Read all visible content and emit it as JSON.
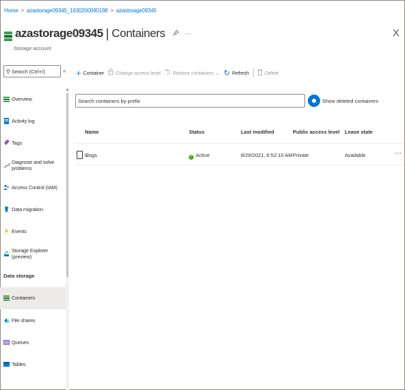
{
  "breadcrumb": {
    "home": "Home",
    "deployment": "azastorage09345_1630200090198",
    "resource": "azastorage09345",
    "separator": ">"
  },
  "header": {
    "resource_name": "azastorage09345",
    "separator": "|",
    "page_title": "Containers",
    "subtitle": "Storage account",
    "pin_icon": "pin-icon",
    "more_icon": "ellipsis-icon",
    "close": "X"
  },
  "sidebar": {
    "search_placeholder": "Search (Ctrl+/)",
    "collapse": "«",
    "items": [
      {
        "label": "Overview",
        "icon": "overview-icon",
        "color": "#37a24a"
      },
      {
        "label": "Activity log",
        "icon": "activity-log-icon",
        "color": "#0078d4"
      },
      {
        "label": "Tags",
        "icon": "tag-icon",
        "color": "#8661c5"
      },
      {
        "label": "Diagnose and solve problems",
        "icon": "wrench-icon",
        "color": "#605e5c"
      },
      {
        "label": "Access Control (IAM)",
        "icon": "people-icon",
        "color": "#0078d4"
      },
      {
        "label": "Data migration",
        "icon": "data-migration-icon",
        "color": "#0078d4"
      },
      {
        "label": "Events",
        "icon": "lightning-icon",
        "color": "#ffb900"
      },
      {
        "label": "Storage Explorer (preview)",
        "icon": "storage-explorer-icon",
        "color": "#0078d4"
      }
    ],
    "section_title": "Data storage",
    "data_items": [
      {
        "label": "Containers",
        "icon": "containers-icon",
        "color": "#37a24a",
        "active": true
      },
      {
        "label": "File shares",
        "icon": "file-shares-icon",
        "color": "#0078d4"
      },
      {
        "label": "Queues",
        "icon": "queues-icon",
        "color": "#8661c5"
      },
      {
        "label": "Tables",
        "icon": "tables-icon",
        "color": "#0078d4"
      }
    ]
  },
  "toolbar": {
    "add_container": "Container",
    "change_access": "Change access level",
    "restore": "Restore containers",
    "refresh": "Refresh",
    "delete": "Delete"
  },
  "filter": {
    "search_placeholder": "Search containers by prefix",
    "toggle_label": "Show deleted containers",
    "toggle_on": true
  },
  "table": {
    "columns": [
      "Name",
      "Status",
      "Last modified",
      "Public access level",
      "Lease state"
    ],
    "rows": [
      {
        "name": "$logs",
        "status": "Active",
        "last_modified": "8/29/2021, 6:52:10 AM",
        "access": "Private",
        "lease": "Available",
        "more": "···"
      }
    ]
  },
  "colors": {
    "accent": "#0078d4",
    "active_status": "#57a300",
    "selected_nav_bg": "#edebe9"
  }
}
